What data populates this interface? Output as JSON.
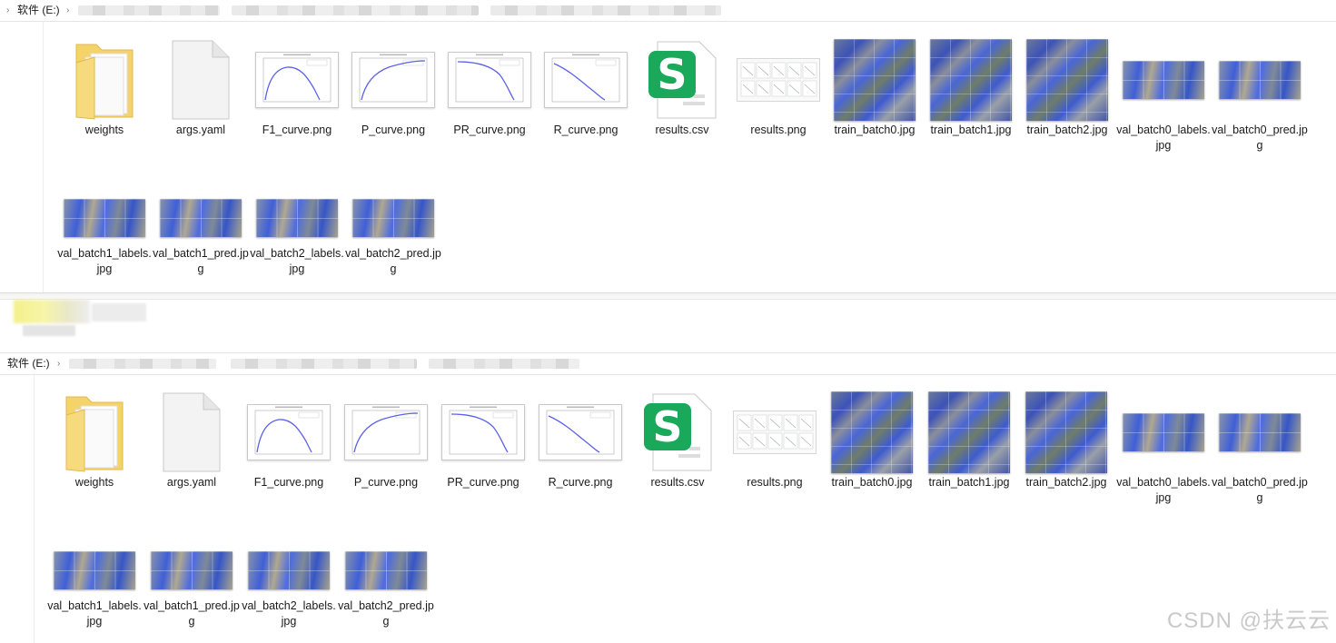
{
  "explorer_panes": [
    {
      "breadcrumb": {
        "drive_label": "软件 (E:)"
      },
      "files": [
        {
          "name": "weights",
          "type": "folder"
        },
        {
          "name": "args.yaml",
          "type": "file"
        },
        {
          "name": "F1_curve.png",
          "type": "chart",
          "curve": "f1"
        },
        {
          "name": "P_curve.png",
          "type": "chart",
          "curve": "p"
        },
        {
          "name": "PR_curve.png",
          "type": "chart",
          "curve": "pr"
        },
        {
          "name": "R_curve.png",
          "type": "chart",
          "curve": "r"
        },
        {
          "name": "results.csv",
          "type": "csv"
        },
        {
          "name": "results.png",
          "type": "results"
        },
        {
          "name": "train_batch0.jpg",
          "type": "photo-square"
        },
        {
          "name": "train_batch1.jpg",
          "type": "photo-square"
        },
        {
          "name": "train_batch2.jpg",
          "type": "photo-square"
        },
        {
          "name": "val_batch0_labels.jpg",
          "type": "photo-wide"
        },
        {
          "name": "val_batch0_pred.jpg",
          "type": "photo-wide"
        },
        {
          "name": "val_batch1_labels.jpg",
          "type": "photo-wide"
        },
        {
          "name": "val_batch1_pred.jpg",
          "type": "photo-wide"
        },
        {
          "name": "val_batch2_labels.jpg",
          "type": "photo-wide"
        },
        {
          "name": "val_batch2_pred.jpg",
          "type": "photo-wide"
        }
      ]
    },
    {
      "breadcrumb": {
        "drive_label": "软件 (E:)"
      },
      "files": [
        {
          "name": "weights",
          "type": "folder"
        },
        {
          "name": "args.yaml",
          "type": "file"
        },
        {
          "name": "F1_curve.png",
          "type": "chart",
          "curve": "f1"
        },
        {
          "name": "P_curve.png",
          "type": "chart",
          "curve": "p"
        },
        {
          "name": "PR_curve.png",
          "type": "chart",
          "curve": "pr"
        },
        {
          "name": "R_curve.png",
          "type": "chart",
          "curve": "r"
        },
        {
          "name": "results.csv",
          "type": "csv"
        },
        {
          "name": "results.png",
          "type": "results"
        },
        {
          "name": "train_batch0.jpg",
          "type": "photo-square"
        },
        {
          "name": "train_batch1.jpg",
          "type": "photo-square"
        },
        {
          "name": "train_batch2.jpg",
          "type": "photo-square"
        },
        {
          "name": "val_batch0_labels.jpg",
          "type": "photo-wide"
        },
        {
          "name": "val_batch0_pred.jpg",
          "type": "photo-wide"
        },
        {
          "name": "val_batch1_labels.jpg",
          "type": "photo-wide"
        },
        {
          "name": "val_batch1_pred.jpg",
          "type": "photo-wide"
        },
        {
          "name": "val_batch2_labels.jpg",
          "type": "photo-wide"
        },
        {
          "name": "val_batch2_pred.jpg",
          "type": "photo-wide"
        }
      ]
    }
  ],
  "colors": {
    "folder": "#f5d36b",
    "csv_green": "#1aa85a",
    "curve": "#5b62e6"
  },
  "watermark": "CSDN @扶云云"
}
